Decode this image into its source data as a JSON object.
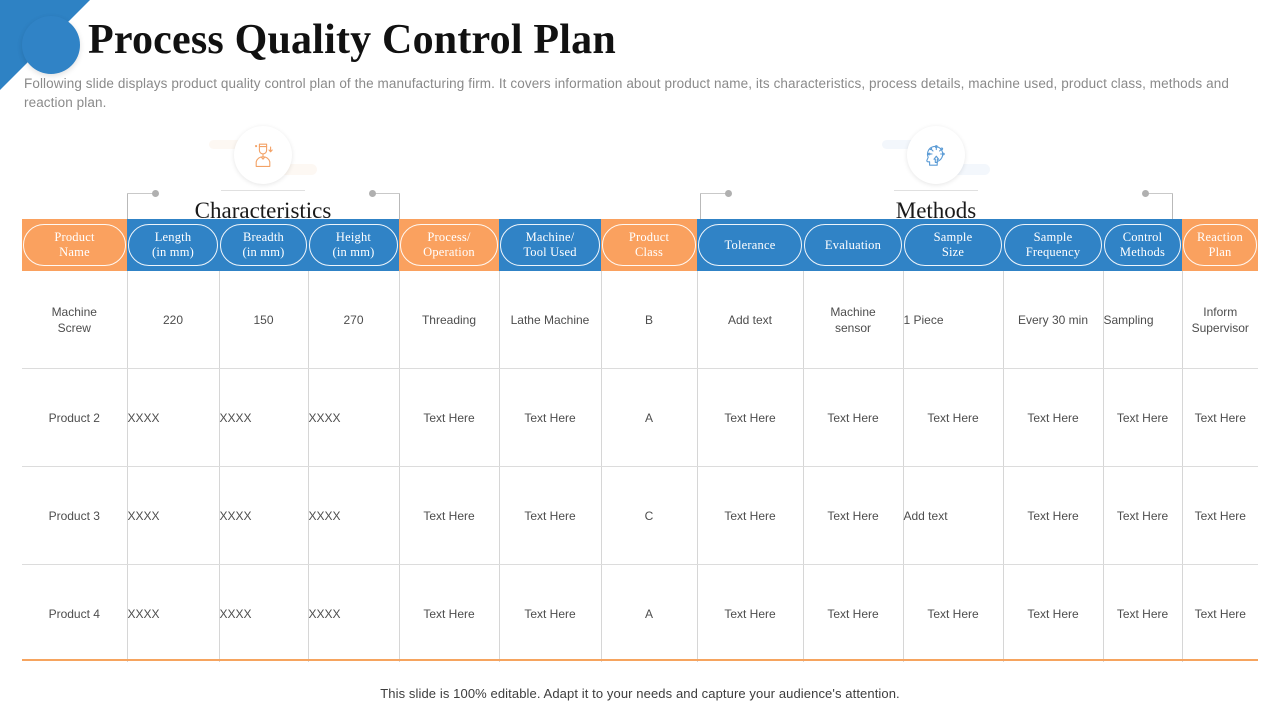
{
  "slide": {
    "title": "Process Quality Control Plan",
    "subtitle": "Following slide displays product quality control plan of the manufacturing firm. It covers information about product name, its characteristics, process details, machine used, product class, methods and reaction plan.",
    "footer_note": "This slide is 100% editable. Adapt it to your needs and capture your audience's attention."
  },
  "colors": {
    "orange": "#FAA15F",
    "blue": "#3083C6",
    "accent_rule": "#F6A45F",
    "grid_line": "#d6d6d6",
    "body_text": "#4d4d4d",
    "subtitle_text": "#8a8a8a"
  },
  "groups": [
    {
      "label": "Characteristics",
      "icon": "quality-inspector-icon",
      "icon_color": "#F3A266",
      "spans_columns": [
        "Length (in mm)",
        "Breadth (in mm)",
        "Height (in mm)"
      ]
    },
    {
      "label": "Methods",
      "icon": "head-idea-icon",
      "icon_color": "#5B9BD5",
      "spans_columns": [
        "Tolerance",
        "Evaluation",
        "Sample Size",
        "Sample Frequency",
        "Control Methods"
      ]
    }
  ],
  "table": {
    "columns": [
      {
        "line1": "Product",
        "line2": "Name",
        "color": "orange"
      },
      {
        "line1": "Length",
        "line2": "(in mm)",
        "color": "blue"
      },
      {
        "line1": "Breadth",
        "line2": "(in mm)",
        "color": "blue"
      },
      {
        "line1": "Height",
        "line2": "(in mm)",
        "color": "blue"
      },
      {
        "line1": "Process/",
        "line2": "Operation",
        "color": "orange"
      },
      {
        "line1": "Machine/",
        "line2": "Tool Used",
        "color": "blue"
      },
      {
        "line1": "Product",
        "line2": "Class",
        "color": "orange"
      },
      {
        "line1": "Tolerance",
        "line2": "",
        "color": "blue"
      },
      {
        "line1": "Evaluation",
        "line2": "",
        "color": "blue"
      },
      {
        "line1": "Sample",
        "line2": "Size",
        "color": "blue"
      },
      {
        "line1": "Sample",
        "line2": "Frequency",
        "color": "blue"
      },
      {
        "line1": "Control",
        "line2": "Methods",
        "color": "blue"
      },
      {
        "line1": "Reaction",
        "line2": "Plan",
        "color": "orange"
      }
    ],
    "rows": [
      {
        "cells": [
          {
            "line1": "Machine",
            "line2": "Screw",
            "align": "center"
          },
          {
            "line1": "220",
            "line2": "",
            "align": "center"
          },
          {
            "line1": "150",
            "line2": "",
            "align": "center"
          },
          {
            "line1": "270",
            "line2": "",
            "align": "center"
          },
          {
            "line1": "Threading",
            "line2": "",
            "align": "center"
          },
          {
            "line1": "Lathe Machine",
            "line2": "",
            "align": "center"
          },
          {
            "line1": "B",
            "line2": "",
            "align": "center"
          },
          {
            "line1": "Add text",
            "line2": "",
            "align": "center"
          },
          {
            "line1": "Machine",
            "line2": "sensor",
            "align": "center"
          },
          {
            "line1": "1 Piece",
            "line2": "",
            "align": "left"
          },
          {
            "line1": "Every 30 min",
            "line2": "",
            "align": "center"
          },
          {
            "line1": "Sampling",
            "line2": "",
            "align": "left"
          },
          {
            "line1": "Inform",
            "line2": "Supervisor",
            "align": "center"
          }
        ]
      },
      {
        "cells": [
          {
            "line1": "Product 2",
            "line2": "",
            "align": "center"
          },
          {
            "line1": "XXXX",
            "line2": "",
            "align": "left"
          },
          {
            "line1": "XXXX",
            "line2": "",
            "align": "left"
          },
          {
            "line1": "XXXX",
            "line2": "",
            "align": "left"
          },
          {
            "line1": "Text Here",
            "line2": "",
            "align": "center"
          },
          {
            "line1": "Text Here",
            "line2": "",
            "align": "center"
          },
          {
            "line1": "A",
            "line2": "",
            "align": "center"
          },
          {
            "line1": "Text Here",
            "line2": "",
            "align": "center"
          },
          {
            "line1": "Text Here",
            "line2": "",
            "align": "center"
          },
          {
            "line1": "Text Here",
            "line2": "",
            "align": "center"
          },
          {
            "line1": "Text Here",
            "line2": "",
            "align": "center"
          },
          {
            "line1": "Text Here",
            "line2": "",
            "align": "center"
          },
          {
            "line1": "Text Here",
            "line2": "",
            "align": "center"
          }
        ]
      },
      {
        "cells": [
          {
            "line1": "Product 3",
            "line2": "",
            "align": "center"
          },
          {
            "line1": "XXXX",
            "line2": "",
            "align": "left"
          },
          {
            "line1": "XXXX",
            "line2": "",
            "align": "left"
          },
          {
            "line1": "XXXX",
            "line2": "",
            "align": "left"
          },
          {
            "line1": "Text Here",
            "line2": "",
            "align": "center"
          },
          {
            "line1": "Text Here",
            "line2": "",
            "align": "center"
          },
          {
            "line1": "C",
            "line2": "",
            "align": "center"
          },
          {
            "line1": "Text Here",
            "line2": "",
            "align": "center"
          },
          {
            "line1": "Text Here",
            "line2": "",
            "align": "center"
          },
          {
            "line1": "Add text",
            "line2": "",
            "align": "left"
          },
          {
            "line1": "Text Here",
            "line2": "",
            "align": "center"
          },
          {
            "line1": "Text Here",
            "line2": "",
            "align": "center"
          },
          {
            "line1": "Text Here",
            "line2": "",
            "align": "center"
          }
        ]
      },
      {
        "cells": [
          {
            "line1": "Product 4",
            "line2": "",
            "align": "center"
          },
          {
            "line1": "XXXX",
            "line2": "",
            "align": "left"
          },
          {
            "line1": "XXXX",
            "line2": "",
            "align": "left"
          },
          {
            "line1": "XXXX",
            "line2": "",
            "align": "left"
          },
          {
            "line1": "Text Here",
            "line2": "",
            "align": "center"
          },
          {
            "line1": "Text Here",
            "line2": "",
            "align": "center"
          },
          {
            "line1": "A",
            "line2": "",
            "align": "center"
          },
          {
            "line1": "Text Here",
            "line2": "",
            "align": "center"
          },
          {
            "line1": "Text Here",
            "line2": "",
            "align": "center"
          },
          {
            "line1": "Text Here",
            "line2": "",
            "align": "center"
          },
          {
            "line1": "Text Here",
            "line2": "",
            "align": "center"
          },
          {
            "line1": "Text Here",
            "line2": "",
            "align": "center"
          },
          {
            "line1": "Text Here",
            "line2": "",
            "align": "center"
          }
        ]
      }
    ]
  }
}
